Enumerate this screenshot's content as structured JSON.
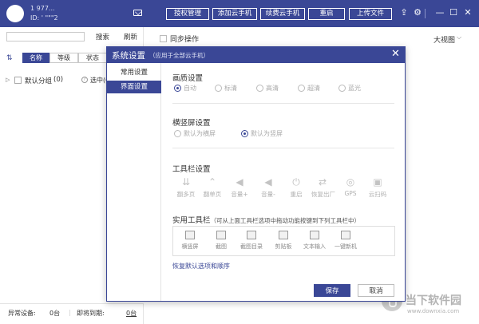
{
  "header": {
    "user_name": "1 977...",
    "user_id": "ID: ' \"\"\"2",
    "buttons": [
      "授权管理",
      "添加云手机",
      "续费云手机",
      "重启",
      "上传文件"
    ],
    "icons": [
      "mail-icon",
      "share-icon",
      "gear-icon",
      "minimize-icon",
      "maximize-icon",
      "close-icon"
    ]
  },
  "sidebar": {
    "search_placeholder": "",
    "search_label": "搜索",
    "refresh_label": "刷新",
    "tabs": [
      "名称",
      "等级",
      "状态"
    ],
    "group": {
      "name": "默认分组",
      "count": "(0)",
      "selected_text": "选中(0"
    }
  },
  "main": {
    "sync_label": "同步操作",
    "view_label": "大视图"
  },
  "status_bar": {
    "abnormal_label": "异常设备:",
    "abnormal_value": "0台",
    "expiring_label": "即将到期:",
    "expiring_value": "0台"
  },
  "watermark": {
    "text": "当下软件园",
    "url": "www.downxia.com"
  },
  "dialog": {
    "title": "系统设置",
    "subtitle": "（应用于全部云手机）",
    "nav": [
      "常用设置",
      "界面设置"
    ],
    "quality": {
      "title": "画质设置",
      "options": [
        "自动",
        "标清",
        "高清",
        "超清",
        "蓝光"
      ],
      "selected": 0
    },
    "orientation": {
      "title": "横竖屏设置",
      "options": [
        "默认为横屏",
        "默认为竖屏"
      ],
      "selected": 1
    },
    "toolbar": {
      "title": "工具栏设置",
      "items": [
        "翻多页",
        "翻单页",
        "音量+",
        "音量-",
        "重启",
        "恢复出厂",
        "GPS",
        "云扫码"
      ]
    },
    "useful": {
      "title": "实用工具栏",
      "note": "（可从上面工具栏选项中拖动功能按键到下列工具栏中）",
      "items": [
        "横竖屏",
        "截图",
        "截图目录",
        "剪贴板",
        "文本输入",
        "一键新机"
      ]
    },
    "restore_label": "恢复默认选项和顺序",
    "save_label": "保存",
    "cancel_label": "取消"
  }
}
